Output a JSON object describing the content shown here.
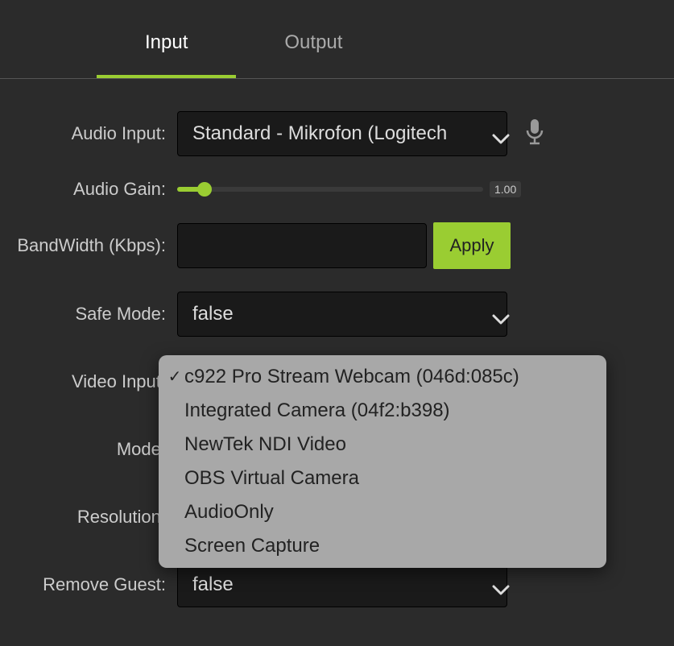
{
  "tabs": {
    "input": "Input",
    "output": "Output",
    "active": "input"
  },
  "form": {
    "audio_input": {
      "label": "Audio Input:",
      "value": "Standard - Mikrofon (Logitech"
    },
    "audio_gain": {
      "label": "Audio Gain:",
      "value": "1.00"
    },
    "bandwidth": {
      "label": "BandWidth (Kbps):",
      "value": "",
      "apply": "Apply"
    },
    "safe_mode": {
      "label": "Safe Mode:",
      "value": "false"
    },
    "video_input": {
      "label": "Video Input:",
      "selected": "c922 Pro Stream Webcam (046d:085c)",
      "options": [
        "c922 Pro Stream Webcam (046d:085c)",
        "Integrated Camera (04f2:b398)",
        "NewTek NDI Video",
        "OBS Virtual Camera",
        "AudioOnly",
        "Screen Capture"
      ]
    },
    "mode": {
      "label": "Mode:"
    },
    "resolution": {
      "label": "Resolution:"
    },
    "remove_guest": {
      "label": "Remove Guest:",
      "value": "false"
    }
  }
}
